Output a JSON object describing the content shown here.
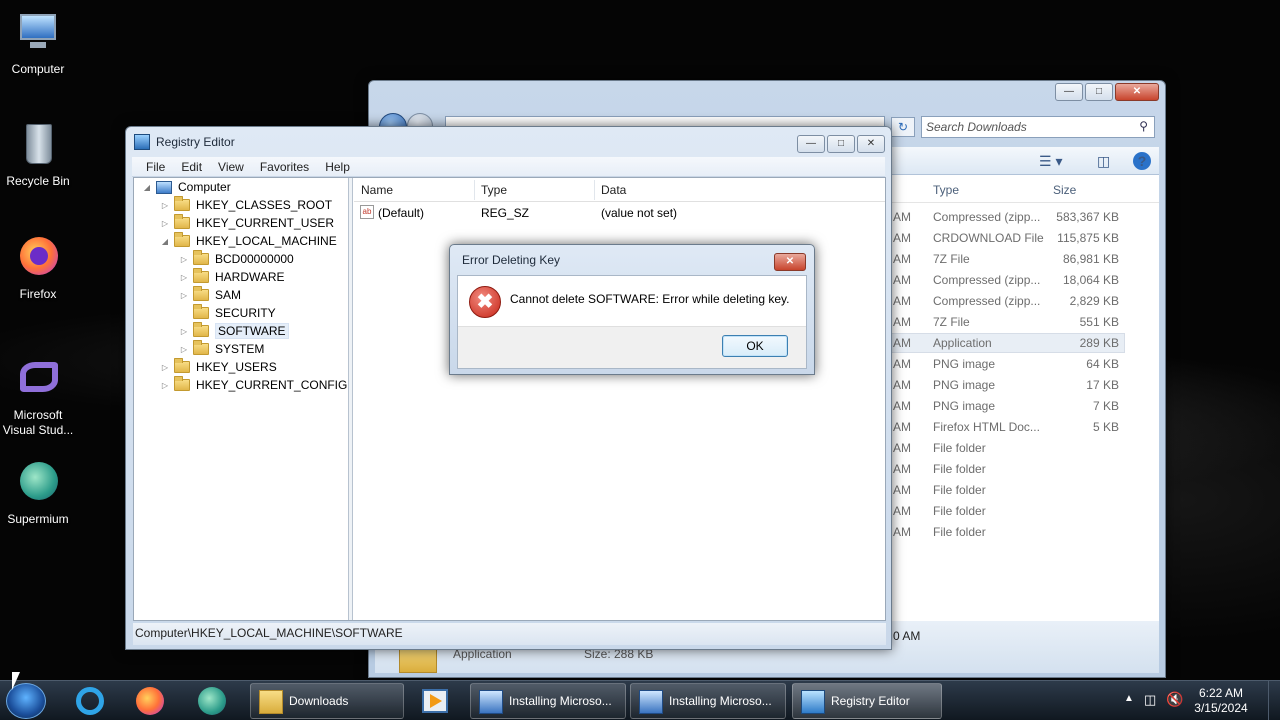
{
  "desktop": {
    "icons": [
      {
        "label": "Computer",
        "icon": "computer-icon"
      },
      {
        "label": "Recycle Bin",
        "icon": "recycle-bin-icon"
      },
      {
        "label": "Firefox",
        "icon": "firefox-icon"
      },
      {
        "label": "Microsoft Visual Stud...",
        "label_line1": "Microsoft",
        "label_line2": "Visual Stud...",
        "icon": "visual-studio-icon"
      },
      {
        "label": "Supermium",
        "icon": "supermium-icon"
      }
    ]
  },
  "explorer": {
    "search_placeholder": "Search Downloads",
    "columns": {
      "type": "Type",
      "size": "Size"
    },
    "rows": [
      {
        "date_suffix": "AM",
        "type": "Compressed (zipp...",
        "size": "583,367 KB"
      },
      {
        "date_suffix": "AM",
        "type": "CRDOWNLOAD File",
        "size": "115,875 KB"
      },
      {
        "date_suffix": "AM",
        "type": "7Z File",
        "size": "86,981 KB"
      },
      {
        "date_suffix": "AM",
        "type": "Compressed (zipp...",
        "size": "18,064 KB"
      },
      {
        "date_suffix": "AM",
        "type": "Compressed (zipp...",
        "size": "2,829 KB"
      },
      {
        "date_suffix": "AM",
        "type": "7Z File",
        "size": "551 KB"
      },
      {
        "date_suffix": "AM",
        "type": "Application",
        "size": "289 KB"
      },
      {
        "date_suffix": "AM",
        "type": "PNG image",
        "size": "64 KB"
      },
      {
        "date_suffix": "AM",
        "type": "PNG image",
        "size": "17 KB"
      },
      {
        "date_suffix": "AM",
        "type": "PNG image",
        "size": "7 KB"
      },
      {
        "date_suffix": "AM",
        "type": "Firefox HTML Doc...",
        "size": "5 KB"
      },
      {
        "date_suffix": "AM",
        "type": "File folder",
        "size": ""
      },
      {
        "date_suffix": "AM",
        "type": "File folder",
        "size": ""
      },
      {
        "date_suffix": "AM",
        "type": "File folder",
        "size": ""
      },
      {
        "date_suffix": "AM",
        "type": "File folder",
        "size": ""
      },
      {
        "date_suffix": "AM",
        "type": "File folder",
        "size": ""
      }
    ],
    "details": {
      "time_fragment": "0 AM",
      "type_label": "Application",
      "size_label": "Size: 288 KB"
    }
  },
  "regedit": {
    "title": "Registry Editor",
    "menu": [
      "File",
      "Edit",
      "View",
      "Favorites",
      "Help"
    ],
    "tree": {
      "root": "Computer",
      "hkcr": "HKEY_CLASSES_ROOT",
      "hkcu": "HKEY_CURRENT_USER",
      "hklm": "HKEY_LOCAL_MACHINE",
      "bcd": "BCD00000000",
      "hardware": "HARDWARE",
      "sam": "SAM",
      "security": "SECURITY",
      "software": "SOFTWARE",
      "system": "SYSTEM",
      "hku": "HKEY_USERS",
      "hkcc": "HKEY_CURRENT_CONFIG"
    },
    "list": {
      "headers": {
        "name": "Name",
        "type": "Type",
        "data": "Data"
      },
      "row": {
        "name": "(Default)",
        "type": "REG_SZ",
        "data": "(value not set)"
      }
    },
    "status": "Computer\\HKEY_LOCAL_MACHINE\\SOFTWARE"
  },
  "dialog": {
    "title": "Error Deleting Key",
    "message": "Cannot delete SOFTWARE:  Error while deleting key.",
    "ok": "OK"
  },
  "taskbar": {
    "tasks": [
      {
        "label": "Downloads",
        "icon": "folder-icon"
      },
      {
        "label": "Installing Microso...",
        "icon": "installer-icon"
      },
      {
        "label": "Installing Microso...",
        "icon": "installer-icon"
      },
      {
        "label": "Registry Editor",
        "icon": "regedit-icon"
      }
    ],
    "time": "6:22 AM",
    "date": "3/15/2024"
  }
}
